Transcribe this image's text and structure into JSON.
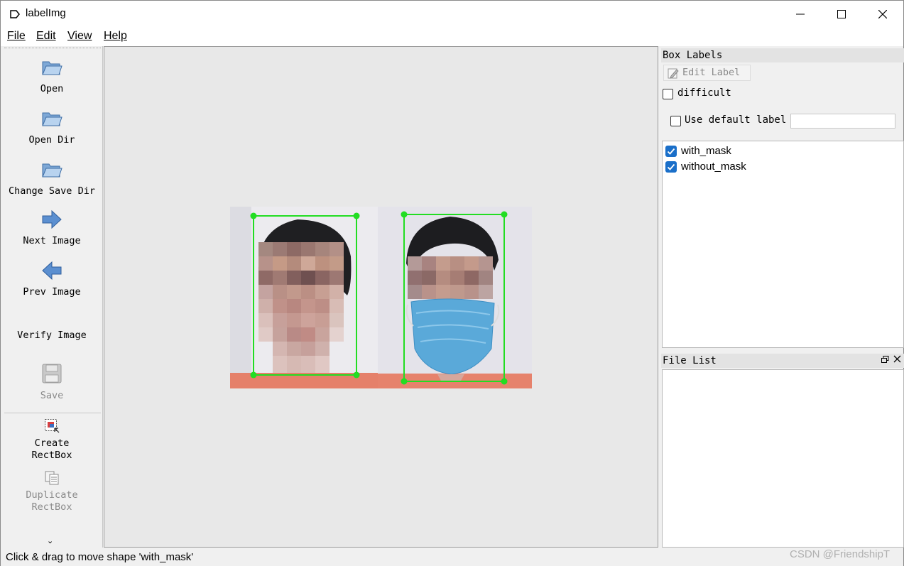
{
  "window": {
    "title": "labelImg",
    "icon": "label-tag-icon",
    "controls": [
      "minimize-icon",
      "maximize-icon",
      "close-icon"
    ]
  },
  "menubar": {
    "file": "File",
    "edit": "Edit",
    "view": "View",
    "help": "Help"
  },
  "toolbar": {
    "open": "Open",
    "open_dir": "Open Dir",
    "change_save_dir": "Change Save Dir",
    "next_image": "Next Image",
    "prev_image": "Prev Image",
    "verify_image": "Verify Image",
    "save": "Save",
    "create_rectbox_1": "Create",
    "create_rectbox_2": "RectBox",
    "duplicate_rectbox_1": "Duplicate",
    "duplicate_rectbox_2": "RectBox",
    "more": "⌄"
  },
  "box_labels": {
    "title": "Box Labels",
    "edit_label": "Edit Label",
    "difficult": "difficult",
    "difficult_checked": false,
    "use_default_label": "Use default label",
    "use_default_checked": false,
    "default_label_value": "",
    "items": [
      {
        "label": "with_mask",
        "checked": true
      },
      {
        "label": "without_mask",
        "checked": true
      }
    ]
  },
  "file_list": {
    "title": "File List",
    "items": []
  },
  "status": {
    "text": "Click & drag to move shape 'with_mask'"
  },
  "watermark": "CSDN @FriendshipT",
  "colors": {
    "box": "#22dd22",
    "checkbox": "#1a6fc9"
  }
}
